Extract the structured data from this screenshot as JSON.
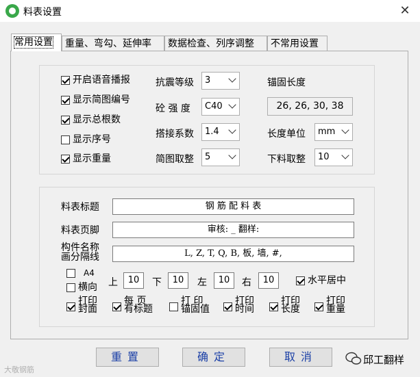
{
  "window": {
    "title": "料表设置",
    "close_glyph": "✕"
  },
  "tabs": [
    {
      "label": "常用设置",
      "active": true
    },
    {
      "label": "重量、弯勾、延伸率"
    },
    {
      "label": "数据检查、列序调整"
    },
    {
      "label": "不常用设置"
    }
  ],
  "options": {
    "voice": {
      "label": "开启语音播报",
      "checked": true
    },
    "diagram_no": {
      "label": "显示简图编号",
      "checked": true
    },
    "total_count": {
      "label": "显示总根数",
      "checked": true
    },
    "seq": {
      "label": "显示序号",
      "checked": false
    },
    "weight": {
      "label": "显示重量",
      "checked": true
    }
  },
  "params": {
    "seismic": {
      "label": "抗震等级",
      "value": "3"
    },
    "concrete": {
      "label": "砼 强 度",
      "value": "C40"
    },
    "splice": {
      "label": "搭接系数",
      "value": "1.4"
    },
    "round": {
      "label": "简图取整",
      "value": "5"
    },
    "anchor": {
      "label": "锚固长度",
      "value": "26, 26, 30, 38"
    },
    "unit": {
      "label": "长度单位",
      "value": "mm"
    },
    "cut_round": {
      "label": "下料取整",
      "value": "10"
    }
  },
  "print": {
    "title": {
      "label": "料表标题",
      "value": "钢 筋 配 料 表"
    },
    "footer": {
      "label": "料表页脚",
      "value": "审核: _ 翻样:"
    },
    "separator": {
      "label_line1": "构件名称",
      "label_line2": "画分隔线",
      "value": "L, Z, T, Q, B, 板, 墙, #,"
    },
    "a4": {
      "label": "A4",
      "checked": false
    },
    "landscape": {
      "label": "横向",
      "checked": false
    },
    "margins": {
      "top": {
        "label": "上",
        "value": "10"
      },
      "bottom": {
        "label": "下",
        "value": "10"
      },
      "left": {
        "label": "左",
        "value": "10"
      },
      "right": {
        "label": "右",
        "value": "10"
      }
    },
    "hcenter": {
      "label": "水平居中",
      "checked": true
    },
    "print_cover": {
      "l1": "打印",
      "l2": "封面",
      "checked": true
    },
    "page_title": {
      "l1": "每 页",
      "l2": "有标题",
      "checked": true
    },
    "print_anchor": {
      "l1": "打 印",
      "l2": "锚固值",
      "checked": false
    },
    "print_time": {
      "l1": "打印",
      "l2": "时间",
      "checked": true
    },
    "print_length": {
      "l1": "打印",
      "l2": "长度",
      "checked": true
    },
    "print_weight": {
      "l1": "打印",
      "l2": "重量",
      "checked": true
    }
  },
  "buttons": {
    "reset": "重置",
    "ok": "确定",
    "cancel": "取消"
  },
  "watermarks": {
    "left": "大敬钢筋",
    "right": "邱工翻样"
  },
  "colors": {
    "button_text": "#1a3fa6",
    "icon_green": "#3aa84a"
  }
}
